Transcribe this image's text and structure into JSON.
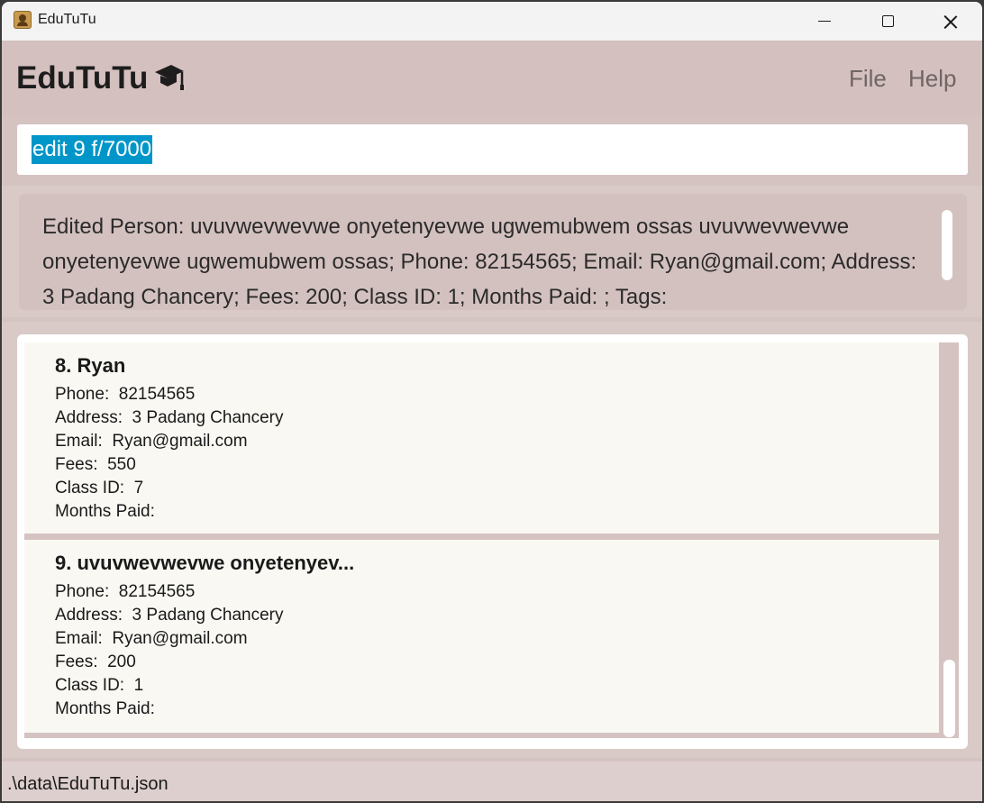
{
  "window": {
    "title": "EduTuTu"
  },
  "header": {
    "app_title": "EduTuTu",
    "menu": [
      {
        "label": "File"
      },
      {
        "label": "Help"
      }
    ]
  },
  "command": {
    "value": "edit 9 f/7000"
  },
  "result": {
    "text": "Edited Person: uvuvwevwevwe onyetenyevwe ugwemubwem ossas uvuvwevwevwe onyetenyevwe ugwemubwem ossas; Phone: 82154565; Email: Ryan@gmail.com; Address: 3 Padang Chancery; Fees: 200; Class ID: 1; Months Paid: ; Tags:"
  },
  "labels": {
    "phone": "Phone:  ",
    "address": "Address:  ",
    "email": "Email:  ",
    "fees": "Fees:  ",
    "class_id": "Class ID:  ",
    "months_paid": "Months Paid: "
  },
  "persons": [
    {
      "name": "8. Ryan",
      "phone": "82154565",
      "address": "3 Padang Chancery",
      "email": "Ryan@gmail.com",
      "fees": "550",
      "class_id": "7",
      "months_paid": ""
    },
    {
      "name": "9. uvuvwevwevwe onyetenyev...",
      "phone": "82154565",
      "address": "3 Padang Chancery",
      "email": "Ryan@gmail.com",
      "fees": "200",
      "class_id": "1",
      "months_paid": ""
    }
  ],
  "status": {
    "file_path": ".\\data\\EduTuTu.json"
  }
}
